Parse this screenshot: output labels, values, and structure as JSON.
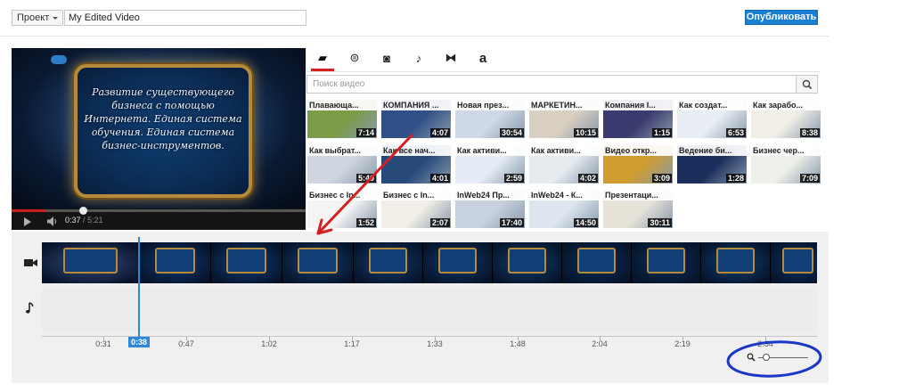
{
  "header": {
    "project_label": "Проект",
    "video_title": "My Edited Video",
    "publish_label": "Опубликовать"
  },
  "player": {
    "slide_text": "Развитие существующего бизнеса с помощью Интернета. Единая система обучения. Единая система бизнес-инструментов.",
    "current_time": "0:37",
    "separator": "/",
    "total_time": "5:21",
    "progress_fraction": 0.115
  },
  "tabs": [
    {
      "name": "video-camera-icon",
      "glyph": "▰"
    },
    {
      "name": "creative-commons-icon",
      "glyph": "⊜"
    },
    {
      "name": "photo-camera-icon",
      "glyph": "◙"
    },
    {
      "name": "music-note-icon",
      "glyph": "♪"
    },
    {
      "name": "transitions-icon",
      "glyph": "⧓"
    },
    {
      "name": "text-icon",
      "glyph": "a"
    }
  ],
  "search": {
    "placeholder": "Поиск видео"
  },
  "thumbnails": [
    {
      "title": "Плавающа...",
      "duration": "7:14",
      "color": "#7b9b46"
    },
    {
      "title": "КОМПАНИЯ ...",
      "duration": "4:07",
      "color": "#2f4f86"
    },
    {
      "title": "Новая през...",
      "duration": "30:54",
      "color": "#cfd8e6"
    },
    {
      "title": "МАРКЕТИН...",
      "duration": "10:15",
      "color": "#d9d0c2"
    },
    {
      "title": "Компания I...",
      "duration": "1:15",
      "color": "#3a3a6e"
    },
    {
      "title": "Как создат...",
      "duration": "6:53",
      "color": "#e8eef4"
    },
    {
      "title": "Как зарабо...",
      "duration": "8:38",
      "color": "#f1eee8"
    },
    {
      "title": "Как выбрат...",
      "duration": "5:40",
      "color": "#cfd6df"
    },
    {
      "title": "Как все нач...",
      "duration": "4:01",
      "color": "#274a7a"
    },
    {
      "title": "Как активи...",
      "duration": "2:59",
      "color": "#e5ecf5"
    },
    {
      "title": "Как активи...",
      "duration": "4:02",
      "color": "#e6ebf0"
    },
    {
      "title": "Видео откр...",
      "duration": "3:09",
      "color": "#cf9c2f"
    },
    {
      "title": "Ведение би...",
      "duration": "1:28",
      "color": "#1c2f5c"
    },
    {
      "title": "Бизнес чер...",
      "duration": "7:09",
      "color": "#eef0ea"
    },
    {
      "title": "Бизнес с In...",
      "duration": "1:52",
      "color": "#f4f4f4"
    },
    {
      "title": "Бизнес с In...",
      "duration": "2:07",
      "color": "#f2efe8"
    },
    {
      "title": "InWeb24 Пр...",
      "duration": "17:40",
      "color": "#c8d2de"
    },
    {
      "title": "InWeb24 - К...",
      "duration": "14:50",
      "color": "#dde6ee"
    },
    {
      "title": "Презентаци...",
      "duration": "30:11",
      "color": "#e6e2d8"
    }
  ],
  "timeline": {
    "video_track_icon": "video-camera-icon",
    "audio_track_icon": "music-note-icon",
    "ticks": [
      "0:31",
      "0:47",
      "1:02",
      "1:17",
      "1:33",
      "1:48",
      "2:04",
      "2:19",
      "2:34"
    ],
    "playhead_label": "0:38",
    "zoom_level": 0.1
  },
  "annotations": {
    "arrow_color": "#d42020",
    "circle_color": "#1a37c6"
  }
}
